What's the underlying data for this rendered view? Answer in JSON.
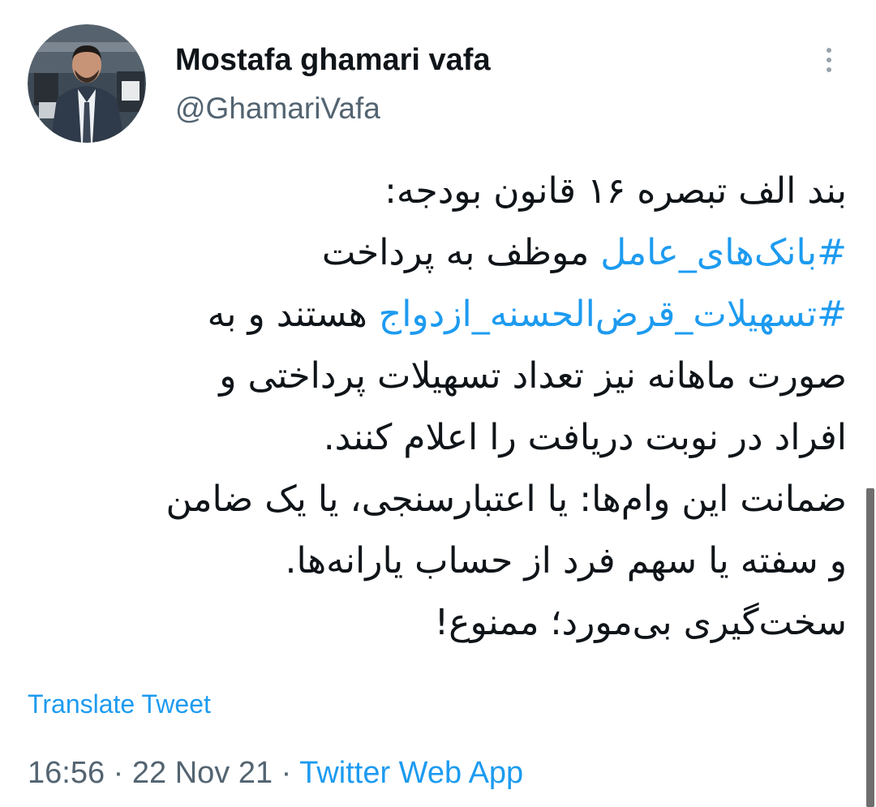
{
  "author": {
    "display_name": "Mostafa ghamari vafa",
    "handle": "@GhamariVafa",
    "avatar_icon": "profile-photo"
  },
  "menu": {
    "icon": "more-vertical-icon"
  },
  "tweet": {
    "line1": "بند الف تبصره ۱۶ قانون بودجه:",
    "line2_hashtag": "#بانک‌های_عامل",
    "line2_text": " موظف به پرداخت",
    "line3_hashtag": "#تسهیلات_قرض‌الحسنه_ازدواج",
    "line3_text": " هستند و به",
    "line4": "صورت ماهانه نیز تعداد تسهیلات پرداختی و",
    "line5": "افراد در نوبت دریافت را اعلام کنند.",
    "line6": "ضمانت این وام‌ها: یا اعتبارسنجی، یا یک ضامن",
    "line7": "و سفته یا سهم فرد از حساب یارانه‌ها.",
    "line8": "سخت‌گیری بی‌مورد؛ ممنوع!"
  },
  "translate_label": "Translate Tweet",
  "meta": {
    "time": "16:56",
    "separator": " · ",
    "date": "22 Nov 21",
    "source": "Twitter Web App"
  },
  "colors": {
    "link": "#1d9bf0",
    "secondary": "#536471",
    "text": "#0f1419"
  }
}
